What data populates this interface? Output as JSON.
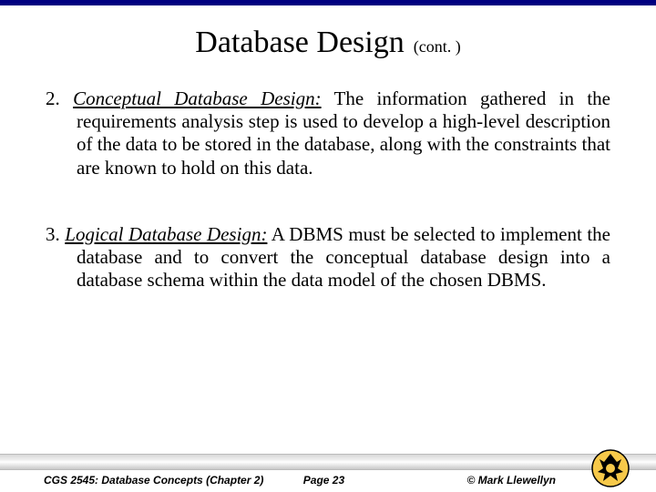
{
  "title": {
    "main": "Database Design",
    "sub": "(cont. )"
  },
  "items": [
    {
      "num": "2.",
      "name": "Conceptual Database Design:",
      "body": "  The information gathered in the requirements analysis step is used to develop a high-level description of the data to be stored in the database, along with the constraints that are known to hold on this data."
    },
    {
      "num": "3.",
      "name": "Logical Database Design:",
      "body": "  A DBMS must be selected to implement the database and to convert the conceptual database design into a database schema within the data model of the chosen DBMS."
    }
  ],
  "footer": {
    "left": "CGS 2545: Database Concepts  (Chapter 2)",
    "mid": "Page 23",
    "right": "© Mark Llewellyn"
  }
}
